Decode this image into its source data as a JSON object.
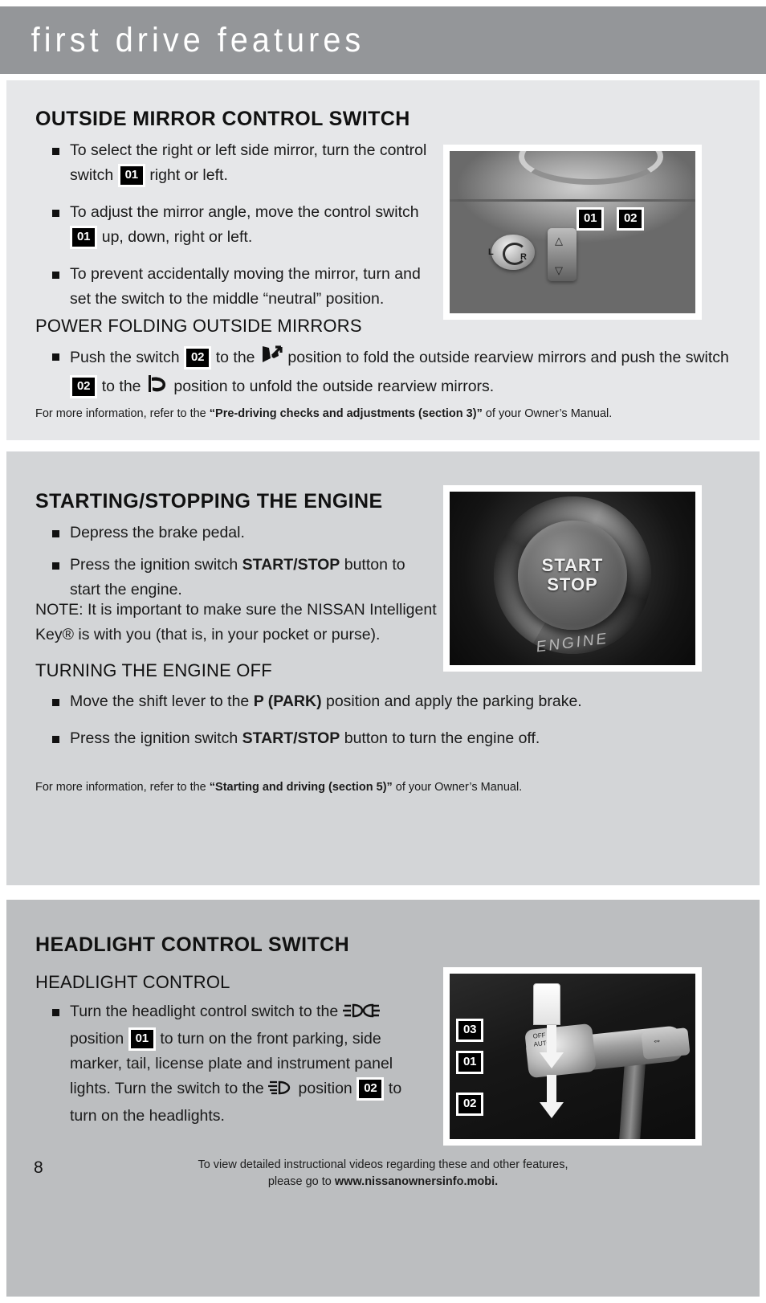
{
  "header": {
    "title": "first drive features"
  },
  "sections": [
    {
      "id": "outside-mirror",
      "title": "OUTSIDE MIRROR CONTROL SWITCH",
      "bullets": [
        {
          "pre": "To select the right or left side mirror, turn the control switch",
          "badge": "01",
          "post": "right or left."
        },
        {
          "pre": "To adjust the mirror angle, move the control switch",
          "badge": "01",
          "post": "up, down, right or left."
        },
        {
          "pre": "To prevent accidentally moving the mirror, turn and set the switch to the middle “neutral” position.",
          "badge": "",
          "post": ""
        }
      ],
      "subtitle": "POWER FOLDING OUTSIDE MIRRORS",
      "fold_bullet": {
        "t1": "Push the switch",
        "badge1": "02",
        "t2": "to the",
        "icon1": "mirror-fold-icon",
        "t3": "position to fold the outside rearview mirrors and push the switch",
        "badge2": "02",
        "t4": "to the",
        "icon2": "mirror-unfold-icon",
        "t5": "position to unfold the outside rearview mirrors."
      },
      "footnote": {
        "pre": "For more information, refer to the ",
        "bold": "“Pre-driving checks and adjustments (section 3)”",
        "post": " of your Owner’s Manual."
      },
      "photo": {
        "name": "mirror-control-switch-photo",
        "callouts": [
          "01",
          "02"
        ],
        "dial_label_l": "L",
        "dial_label_r": "R"
      }
    },
    {
      "id": "starting-stopping",
      "title": "STARTING/STOPPING THE ENGINE",
      "bullets": [
        {
          "pre": "Depress the brake pedal.",
          "bold": "",
          "post": ""
        },
        {
          "pre": "Press the ignition switch ",
          "bold": "START/STOP",
          "post": " button to start the engine."
        }
      ],
      "note": "NOTE: It is important to make sure the NISSAN Intelligent Key® is with you (that is, in your pocket or purse).",
      "subtitle": "TURNING THE ENGINE OFF",
      "bullets2": [
        {
          "pre": "Move the shift lever to the ",
          "bold": "P (PARK)",
          "post": " position and apply the parking brake."
        },
        {
          "pre": "Press the ignition switch ",
          "bold": "START/STOP",
          "post": " button to turn the engine off."
        }
      ],
      "footnote": {
        "pre": "For more information, refer to the ",
        "bold": "“Starting and driving (section 5)”",
        "post": " of your Owner’s Manual."
      },
      "photo": {
        "name": "start-stop-button-photo",
        "button_line1": "START",
        "button_line2": "STOP",
        "engine_label": "ENGINE"
      }
    },
    {
      "id": "headlight-control",
      "title": "HEADLIGHT CONTROL SWITCH",
      "subtitle": "HEADLIGHT CONTROL",
      "bullet": {
        "t1": "Turn the headlight control switch to the",
        "icon1": "parking-light-icon",
        "t2": "position",
        "badge1": "01",
        "t3": "to turn on the front parking, side marker, tail, license plate and instrument panel lights. Turn the switch to the",
        "icon2": "low-beam-headlight-icon",
        "t4": "position",
        "badge2": "02",
        "t5": "to turn on the headlights."
      },
      "photo": {
        "name": "headlight-stalk-photo",
        "callouts": [
          "03",
          "01",
          "02"
        ],
        "stalk_marks": [
          "OFF",
          "AUTO"
        ]
      }
    }
  ],
  "footer": {
    "line1": "To view detailed instructional videos regarding these and other features,",
    "line2_pre": "please go to ",
    "line2_bold": "www.nissanownersinfo.mobi.",
    "page_number": "8"
  },
  "colors": {
    "header_band": "#949699",
    "panel1": "#e6e7e9",
    "panel2": "#d3d5d7",
    "panel3": "#bcbec0",
    "badge_bg": "#000000",
    "text": "#1a1a1a"
  }
}
